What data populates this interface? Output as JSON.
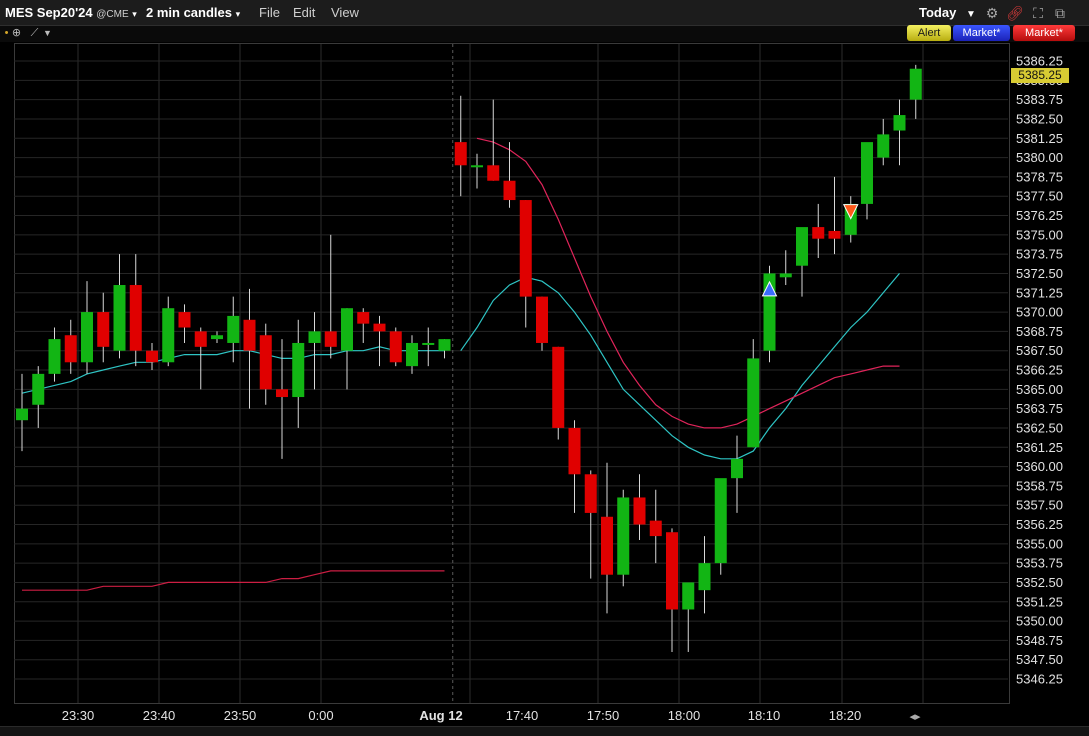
{
  "titlebar": {
    "symbol": "MES Sep20'24",
    "exchange": "@CME",
    "period": "2 min candles",
    "menu_file": "File",
    "menu_edit": "Edit",
    "menu_view": "View",
    "range": "Today"
  },
  "order_buttons": {
    "alert": "Alert",
    "buy": "Market*",
    "sell": "Market*"
  },
  "icons": [
    "settings-gear-icon",
    "link-icon",
    "expand-icon",
    "detach-icon",
    "crosshair-icon",
    "draw-tools-icon"
  ],
  "colors": {
    "up_candle": "#12b514",
    "down_candle": "#e00000",
    "ma_fast": "#e0245a",
    "ma_mid": "#2ec4c4",
    "ma_slow": "#cc1e43",
    "last_price_bg": "#d8cb33",
    "buy_marker": "#3a6cff",
    "sell_marker": "#ff5a1a"
  },
  "last_price": "5385.25",
  "chart_data": {
    "type": "candlestick",
    "y_ticks": [
      "5386.25",
      "5385.00",
      "5383.75",
      "5382.50",
      "5381.25",
      "5380.00",
      "5378.75",
      "5377.50",
      "5376.25",
      "5375.00",
      "5373.75",
      "5372.50",
      "5371.25",
      "5370.00",
      "5368.75",
      "5367.50",
      "5366.25",
      "5365.00",
      "5363.75",
      "5362.50",
      "5361.25",
      "5360.00",
      "5358.75",
      "5357.50",
      "5356.25",
      "5355.00",
      "5353.75",
      "5352.50",
      "5351.25",
      "5350.00",
      "5348.75",
      "5347.50",
      "5346.25"
    ],
    "x_ticks": [
      "23:30",
      "23:40",
      "23:50",
      "0:00",
      "Aug 12",
      "17:40",
      "17:50",
      "18:00",
      "18:10",
      "18:20"
    ],
    "ylim": [
      5345.5,
      5387.0
    ],
    "session_break_index": 27,
    "candles": [
      {
        "o": 5363.0,
        "h": 5366.0,
        "l": 5361.0,
        "c": 5363.75
      },
      {
        "o": 5364.0,
        "h": 5366.5,
        "l": 5362.5,
        "c": 5366.0
      },
      {
        "o": 5366.0,
        "h": 5369.0,
        "l": 5365.5,
        "c": 5368.25
      },
      {
        "o": 5368.5,
        "h": 5369.5,
        "l": 5366.0,
        "c": 5366.75
      },
      {
        "o": 5366.75,
        "h": 5372.0,
        "l": 5366.0,
        "c": 5370.0
      },
      {
        "o": 5370.0,
        "h": 5371.25,
        "l": 5366.75,
        "c": 5367.75
      },
      {
        "o": 5367.5,
        "h": 5373.75,
        "l": 5367.0,
        "c": 5371.75
      },
      {
        "o": 5371.75,
        "h": 5373.75,
        "l": 5366.5,
        "c": 5367.5
      },
      {
        "o": 5367.5,
        "h": 5368.0,
        "l": 5366.25,
        "c": 5366.75
      },
      {
        "o": 5366.75,
        "h": 5371.0,
        "l": 5366.5,
        "c": 5370.25
      },
      {
        "o": 5370.0,
        "h": 5370.5,
        "l": 5368.0,
        "c": 5369.0
      },
      {
        "o": 5368.75,
        "h": 5369.0,
        "l": 5365.0,
        "c": 5367.75
      },
      {
        "o": 5368.25,
        "h": 5368.75,
        "l": 5368.0,
        "c": 5368.5
      },
      {
        "o": 5368.0,
        "h": 5371.0,
        "l": 5366.75,
        "c": 5369.75
      },
      {
        "o": 5369.5,
        "h": 5371.5,
        "l": 5363.75,
        "c": 5367.5
      },
      {
        "o": 5368.5,
        "h": 5369.25,
        "l": 5364.0,
        "c": 5365.0
      },
      {
        "o": 5365.0,
        "h": 5368.25,
        "l": 5360.5,
        "c": 5364.5
      },
      {
        "o": 5364.5,
        "h": 5369.5,
        "l": 5362.5,
        "c": 5368.0
      },
      {
        "o": 5368.0,
        "h": 5370.0,
        "l": 5365.0,
        "c": 5368.75
      },
      {
        "o": 5368.75,
        "h": 5375.0,
        "l": 5367.0,
        "c": 5367.75
      },
      {
        "o": 5367.5,
        "h": 5370.25,
        "l": 5365.0,
        "c": 5370.25
      },
      {
        "o": 5370.0,
        "h": 5370.25,
        "l": 5368.0,
        "c": 5369.25
      },
      {
        "o": 5369.25,
        "h": 5369.75,
        "l": 5366.5,
        "c": 5368.75
      },
      {
        "o": 5368.75,
        "h": 5369.0,
        "l": 5366.5,
        "c": 5366.75
      },
      {
        "o": 5366.5,
        "h": 5368.5,
        "l": 5366.0,
        "c": 5368.0
      },
      {
        "o": 5368.0,
        "h": 5369.0,
        "l": 5366.5,
        "c": 5368.0
      },
      {
        "o": 5367.5,
        "h": 5368.25,
        "l": 5367.0,
        "c": 5368.25
      },
      {
        "o": 5381.0,
        "h": 5384.0,
        "l": 5377.5,
        "c": 5379.5
      },
      {
        "o": 5379.5,
        "h": 5380.25,
        "l": 5378.0,
        "c": 5379.5
      },
      {
        "o": 5379.5,
        "h": 5383.75,
        "l": 5378.5,
        "c": 5378.5
      },
      {
        "o": 5378.5,
        "h": 5381.0,
        "l": 5376.75,
        "c": 5377.25
      },
      {
        "o": 5377.25,
        "h": 5377.25,
        "l": 5369.0,
        "c": 5371.0
      },
      {
        "o": 5371.0,
        "h": 5371.0,
        "l": 5367.5,
        "c": 5368.0
      },
      {
        "o": 5367.75,
        "h": 5367.75,
        "l": 5361.75,
        "c": 5362.5
      },
      {
        "o": 5362.5,
        "h": 5363.0,
        "l": 5357.0,
        "c": 5359.5
      },
      {
        "o": 5359.5,
        "h": 5359.75,
        "l": 5352.75,
        "c": 5357.0
      },
      {
        "o": 5356.75,
        "h": 5360.25,
        "l": 5350.5,
        "c": 5353.0
      },
      {
        "o": 5353.0,
        "h": 5358.5,
        "l": 5352.25,
        "c": 5358.0
      },
      {
        "o": 5358.0,
        "h": 5359.5,
        "l": 5355.25,
        "c": 5356.25
      },
      {
        "o": 5356.5,
        "h": 5358.5,
        "l": 5353.75,
        "c": 5355.5
      },
      {
        "o": 5355.75,
        "h": 5356.0,
        "l": 5348.0,
        "c": 5350.75
      },
      {
        "o": 5350.75,
        "h": 5352.0,
        "l": 5348.0,
        "c": 5352.5
      },
      {
        "o": 5352.0,
        "h": 5355.5,
        "l": 5350.5,
        "c": 5353.75
      },
      {
        "o": 5353.75,
        "h": 5359.0,
        "l": 5353.0,
        "c": 5359.25
      },
      {
        "o": 5359.25,
        "h": 5362.0,
        "l": 5357.0,
        "c": 5360.5
      },
      {
        "o": 5361.25,
        "h": 5368.25,
        "l": 5361.25,
        "c": 5367.0
      },
      {
        "o": 5367.5,
        "h": 5373.0,
        "l": 5366.75,
        "c": 5372.5
      },
      {
        "o": 5372.25,
        "h": 5374.0,
        "l": 5371.75,
        "c": 5372.5
      },
      {
        "o": 5373.0,
        "h": 5375.0,
        "l": 5371.0,
        "c": 5375.5
      },
      {
        "o": 5375.5,
        "h": 5377.0,
        "l": 5373.5,
        "c": 5374.75
      },
      {
        "o": 5375.25,
        "h": 5378.75,
        "l": 5373.75,
        "c": 5374.75
      },
      {
        "o": 5375.0,
        "h": 5377.5,
        "l": 5374.5,
        "c": 5377.0
      },
      {
        "o": 5377.0,
        "h": 5380.5,
        "l": 5376.0,
        "c": 5381.0
      },
      {
        "o": 5380.0,
        "h": 5382.5,
        "l": 5379.5,
        "c": 5381.5
      },
      {
        "o": 5381.75,
        "h": 5383.75,
        "l": 5379.5,
        "c": 5382.75
      },
      {
        "o": 5383.75,
        "h": 5386.0,
        "l": 5382.5,
        "c": 5385.75
      }
    ],
    "series": [
      {
        "values": [
          5364.75,
          5365.0,
          5365.25,
          5365.5,
          5366.0,
          5366.25,
          5366.5,
          5366.75,
          5366.75,
          5367.0,
          5367.25,
          5367.25,
          5367.25,
          5367.5,
          5367.5,
          5367.25,
          5367.0,
          5367.0,
          5367.25,
          5367.25,
          5367.5,
          5367.5,
          5367.75,
          5367.5,
          5367.5,
          5367.5,
          5367.5,
          5367.5,
          5369.0,
          5370.75,
          5371.75,
          5372.25,
          5372.0,
          5371.25,
          5370.0,
          5368.5,
          5366.75,
          5365.0,
          5364.0,
          5363.0,
          5362.0,
          5361.25,
          5360.75,
          5360.5,
          5360.5,
          5361.0,
          5362.5,
          5363.75,
          5365.25,
          5366.5,
          5367.75,
          5369.0,
          5370.0,
          5371.25,
          5372.5
        ]
      },
      {
        "values": [
          null,
          null,
          null,
          null,
          null,
          null,
          null,
          null,
          null,
          null,
          null,
          null,
          null,
          null,
          null,
          null,
          null,
          null,
          null,
          null,
          null,
          null,
          null,
          null,
          null,
          null,
          null,
          null,
          5381.25,
          5381.0,
          5380.5,
          5379.75,
          5378.25,
          5376.0,
          5373.5,
          5371.0,
          5368.75,
          5366.75,
          5365.25,
          5364.0,
          5363.25,
          5362.75,
          5362.5,
          5362.5,
          5362.75,
          5363.25,
          5363.75,
          5364.25,
          5364.75,
          5365.25,
          5365.75,
          5366.0,
          5366.25,
          5366.5,
          5366.5
        ]
      },
      {
        "values": [
          5352.0,
          5352.0,
          5352.0,
          5352.0,
          5352.0,
          5352.25,
          5352.25,
          5352.25,
          5352.25,
          5352.5,
          5352.5,
          5352.5,
          5352.5,
          5352.5,
          5352.5,
          5352.5,
          5352.75,
          5352.75,
          5353.0,
          5353.25,
          5353.25,
          5353.25,
          5353.25,
          5353.25,
          5353.25,
          5353.25,
          5353.25
        ]
      }
    ],
    "signals": [
      {
        "type": "buy",
        "index": 46,
        "price": 5371.5
      },
      {
        "type": "sell",
        "index": 51,
        "price": 5376.5
      }
    ]
  }
}
